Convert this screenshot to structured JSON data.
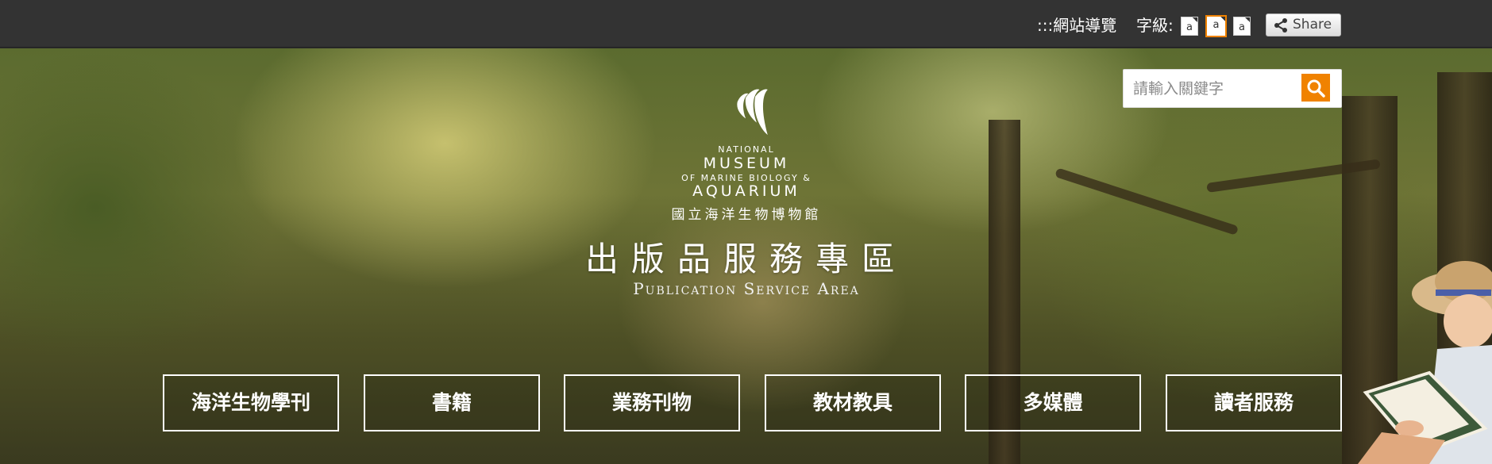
{
  "topbar": {
    "sitemap_label": ":::網站導覽",
    "font_size_label": "字級:",
    "font_size_options": [
      "a",
      "a",
      "a"
    ],
    "font_size_active_index": 1,
    "share_label": "Share",
    "share_icon": "share-icon"
  },
  "search": {
    "placeholder": "請輸入關鍵字",
    "button_icon": "search-icon"
  },
  "logo": {
    "national": "NATIONAL",
    "museum": "MUSEUM",
    "of_marine": "OF MARINE BIOLOGY &",
    "aquarium": "AQUARIUM",
    "name_zh": "國立海洋生物博物館"
  },
  "hero": {
    "title_zh": "出版品服務專區",
    "title_en": "Publication Service Area"
  },
  "nav": {
    "items": [
      {
        "label": "海洋生物學刊"
      },
      {
        "label": "書籍"
      },
      {
        "label": "業務刊物"
      },
      {
        "label": "教材教具"
      },
      {
        "label": "多媒體"
      },
      {
        "label": "讀者服務"
      }
    ]
  },
  "colors": {
    "accent": "#f08200",
    "topbar": "#333333"
  }
}
